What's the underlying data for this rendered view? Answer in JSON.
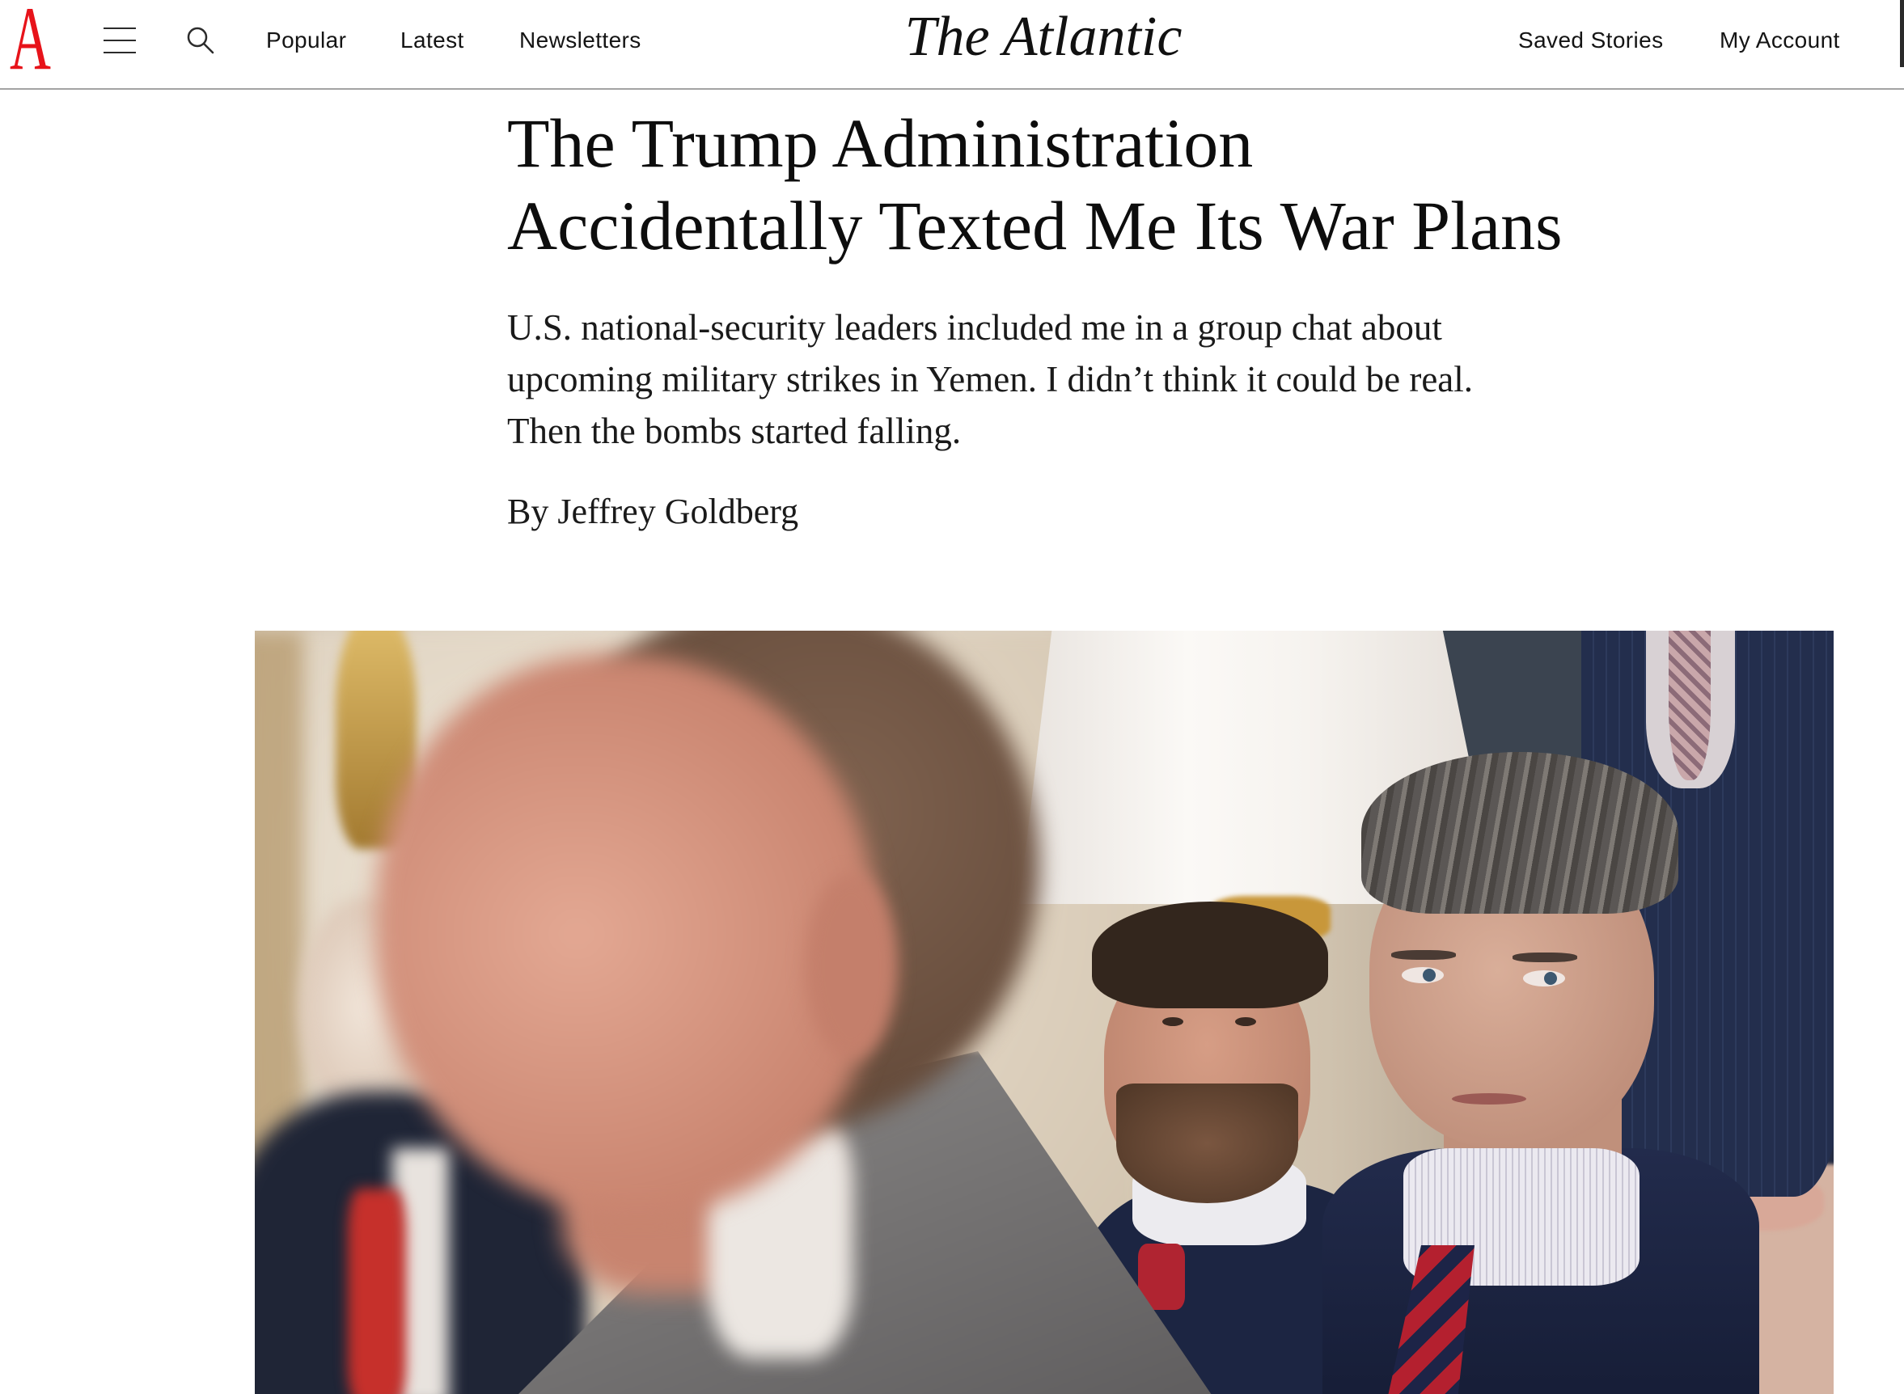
{
  "header": {
    "logo_letter": "A",
    "nav": {
      "popular": "Popular",
      "latest": "Latest",
      "newsletters": "Newsletters"
    },
    "brand": "The Atlantic",
    "saved_stories": "Saved Stories",
    "my_account": "My Account",
    "icons": {
      "menu": "hamburger-menu-icon",
      "search": "search-icon"
    }
  },
  "article": {
    "headline": "The Trump Administration Accidentally Texted Me Its War Plans",
    "dek": "U.S. national-security leaders included me in a group chat about upcoming military strikes in Yemen. I didn’t think it could be real. Then the bombs started falling.",
    "byline_prefix": "By",
    "author": "Jeffrey Goldberg"
  },
  "colors": {
    "brand_red": "#e7131a",
    "text": "#111111",
    "header_rule": "#a3a3a3",
    "background": "#ffffff"
  }
}
